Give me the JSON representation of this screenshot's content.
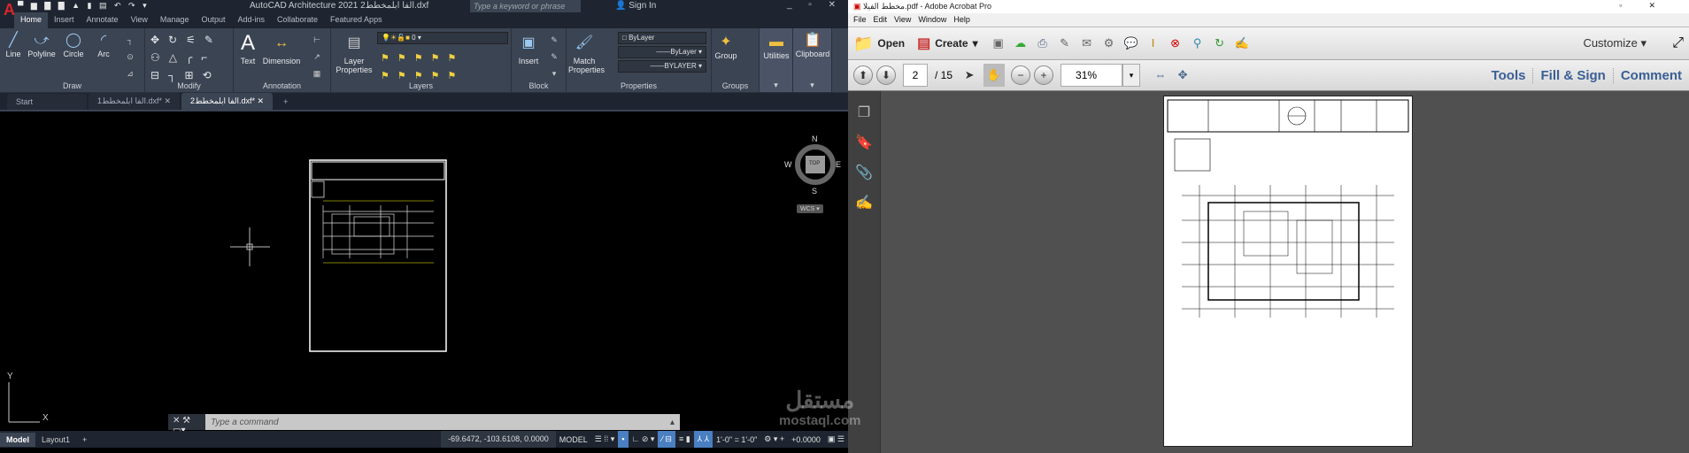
{
  "autocad": {
    "title": "AutoCAD Architecture 2021   2الفا ابلمخطط.dxf",
    "search_placeholder": "Type a keyword or phrase",
    "sign_in": "Sign In",
    "ribbon_tabs": [
      "Home",
      "Insert",
      "Annotate",
      "View",
      "Manage",
      "Output",
      "Add-ins",
      "Collaborate",
      "Featured Apps"
    ],
    "panels": {
      "draw": "Draw",
      "modify": "Modify",
      "annotation": "Annotation",
      "layers": "Layers",
      "block": "Block",
      "properties": "Properties",
      "groups": "Groups"
    },
    "tools": {
      "line": "Line",
      "polyline": "Polyline",
      "circle": "Circle",
      "arc": "Arc",
      "text": "Text",
      "dimension": "Dimension",
      "layer_properties": "Layer Properties",
      "insert": "Insert",
      "match_properties": "Match Properties",
      "group": "Group",
      "utilities": "Utilities",
      "clipboard": "Clipboard"
    },
    "layer_value": "0",
    "color_value": "ByLayer",
    "linetype_value": "ByLayer",
    "lineweight_value": "BYLAYER",
    "doc_tabs": [
      "Start",
      "1الفا ابلمخطط.dxf*",
      "2الفا ابلمخطط.dxf*"
    ],
    "viewcube": {
      "n": "N",
      "s": "S",
      "e": "E",
      "w": "W",
      "top": "TOP",
      "wcs": "WCS"
    },
    "ucs": {
      "x": "X",
      "y": "Y"
    },
    "command_placeholder": "Type a command",
    "layout_tabs": [
      "Model",
      "Layout1"
    ],
    "coords": "-69.6472, -103.6108, 0.0000",
    "model_label": "MODEL",
    "scale": "1'-0\" = 1'-0\"",
    "annotation_value": "+0.0000"
  },
  "acrobat": {
    "title": "مخطط الفيلا.pdf - Adobe Acrobat Pro",
    "menu": [
      "File",
      "Edit",
      "View",
      "Window",
      "Help"
    ],
    "open": "Open",
    "create": "Create",
    "customize": "Customize",
    "page_current": "2",
    "page_total": "/ 15",
    "zoom": "31%",
    "links": [
      "Tools",
      "Fill & Sign",
      "Comment"
    ]
  },
  "watermark": {
    "arabic": "مستقل",
    "latin": "mostaql.com"
  }
}
